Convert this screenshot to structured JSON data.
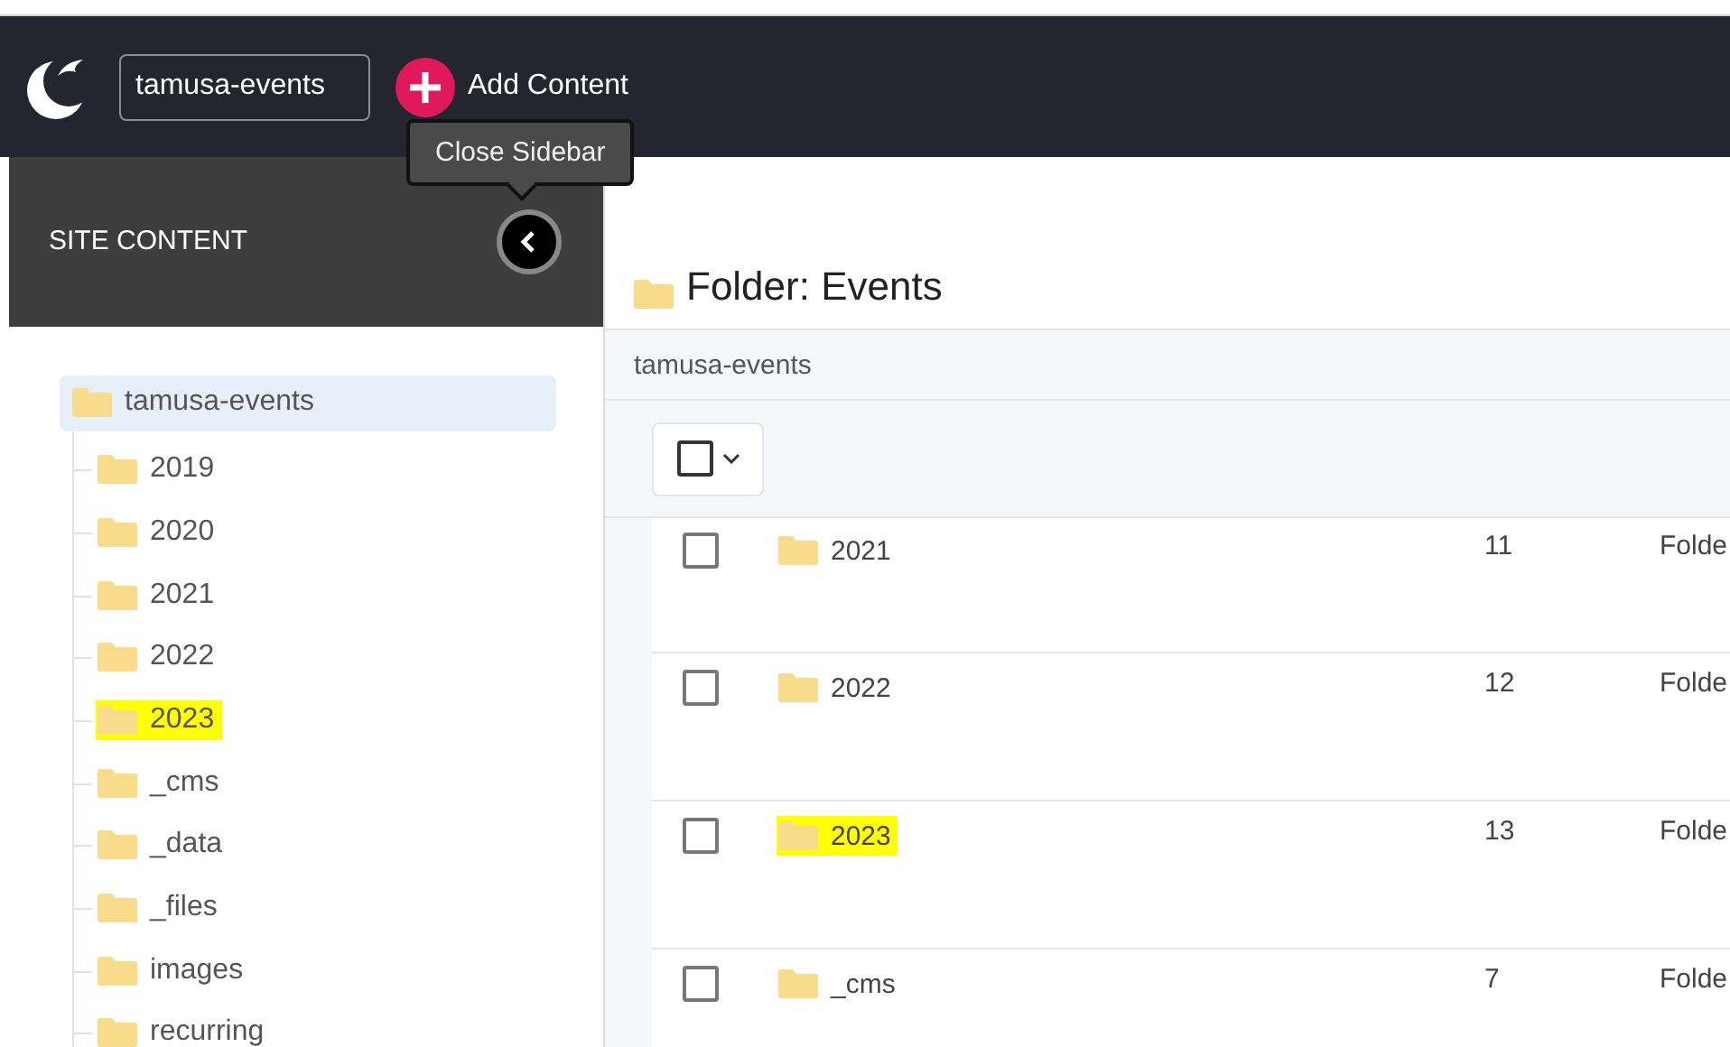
{
  "header": {
    "site_field": "tamusa-events",
    "add_button": "Add Content",
    "tooltip": "Close Sidebar"
  },
  "sidebar": {
    "title": "SITE CONTENT",
    "tree": [
      {
        "label": "tamusa-events",
        "selected": true,
        "highlighted": false,
        "children": [
          {
            "label": "2019",
            "selected": false,
            "highlighted": false
          },
          {
            "label": "2020",
            "selected": false,
            "highlighted": false
          },
          {
            "label": "2021",
            "selected": false,
            "highlighted": false
          },
          {
            "label": "2022",
            "selected": false,
            "highlighted": false
          },
          {
            "label": "2023",
            "selected": false,
            "highlighted": true
          },
          {
            "label": "_cms",
            "selected": false,
            "highlighted": false
          },
          {
            "label": "_data",
            "selected": false,
            "highlighted": false
          },
          {
            "label": "_files",
            "selected": false,
            "highlighted": false
          },
          {
            "label": "images",
            "selected": false,
            "highlighted": false
          },
          {
            "label": "recurring",
            "selected": false,
            "highlighted": false
          }
        ]
      }
    ]
  },
  "main": {
    "title": "Folder: Events",
    "breadcrumb": "tamusa-events",
    "select_all": {
      "checked": false
    },
    "rows": [
      {
        "name": "2021",
        "column_2": "11",
        "column_3": "Folde",
        "checked": false,
        "highlighted": false
      },
      {
        "name": "2022",
        "column_2": "12",
        "column_3": "Folde",
        "checked": false,
        "highlighted": false
      },
      {
        "name": "2023",
        "column_2": "13",
        "column_3": "Folde",
        "checked": false,
        "highlighted": true
      },
      {
        "name": "_cms",
        "column_2": "7",
        "column_3": "Folde",
        "checked": false,
        "highlighted": false
      }
    ]
  }
}
